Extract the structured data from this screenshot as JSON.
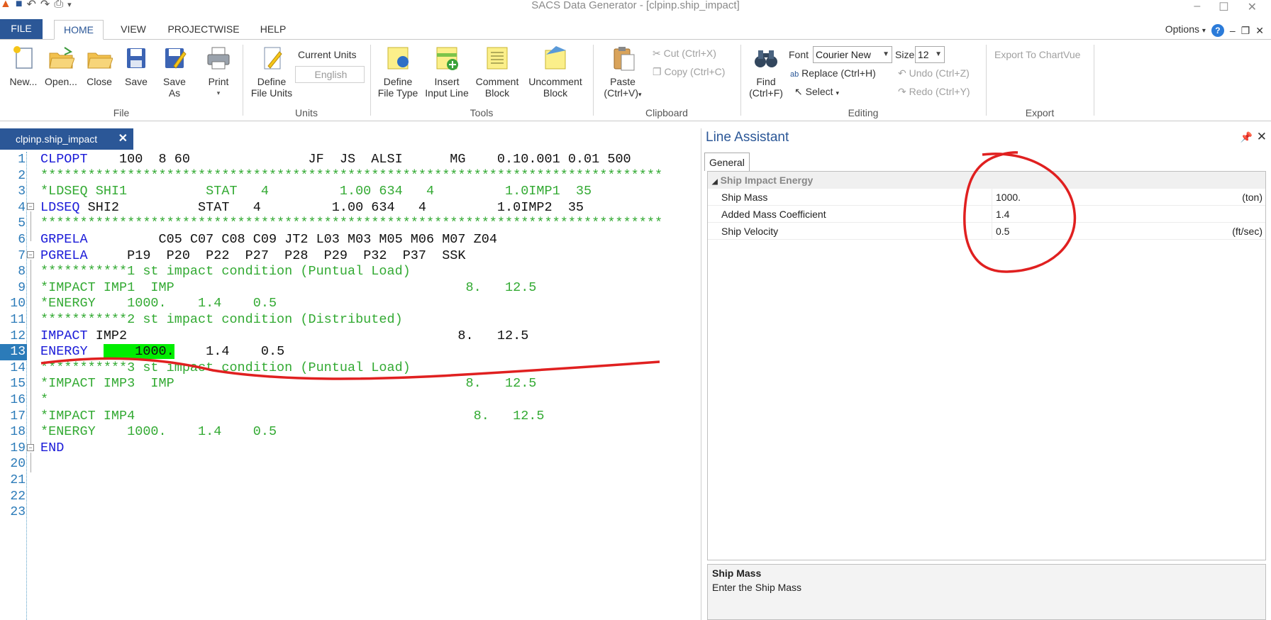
{
  "window": {
    "title": "SACS Data Generator - [clpinp.ship_impact]"
  },
  "ribbon_tabs": [
    "FILE",
    "HOME",
    "VIEW",
    "PROJECTWISE",
    "HELP"
  ],
  "options": {
    "label": "Options"
  },
  "ribbon": {
    "file_group": {
      "label": "File",
      "new": "New...",
      "open": "Open...",
      "close": "Close",
      "save": "Save",
      "save_as_1": "Save",
      "save_as_2": "As",
      "print": "Print"
    },
    "units_group": {
      "label": "Units",
      "define_1": "Define",
      "define_2": "File Units",
      "current_units_label": "Current Units",
      "current_units_value": "English"
    },
    "tools_group": {
      "label": "Tools",
      "define_type_1": "Define",
      "define_type_2": "File Type",
      "insert_1": "Insert",
      "insert_2": "Input Line",
      "comment_1": "Comment",
      "comment_2": "Block",
      "uncomment_1": "Uncomment",
      "uncomment_2": "Block"
    },
    "clipboard_group": {
      "label": "Clipboard",
      "paste_1": "Paste",
      "paste_2": "(Ctrl+V)",
      "cut": "Cut (Ctrl+X)",
      "copy": "Copy (Ctrl+C)"
    },
    "editing_group": {
      "label": "Editing",
      "find_1": "Find",
      "find_2": "(Ctrl+F)",
      "font_label": "Font",
      "font_value": "Courier New",
      "size_label": "Size",
      "size_value": "12",
      "replace": "Replace (Ctrl+H)",
      "select": "Select",
      "undo": "Undo (Ctrl+Z)",
      "redo": "Redo (Ctrl+Y)"
    },
    "export_group": {
      "label": "Export",
      "export_chartvue": "Export To ChartVue"
    }
  },
  "editor": {
    "tab_label": "clpinp.ship_impact",
    "lines": [
      {
        "n": "1",
        "parts": [
          [
            "kw",
            "CLPOPT"
          ],
          [
            "tx",
            "    100  8 60               JF  JS  ALSI      MG    0.10.001 0.01 500"
          ]
        ]
      },
      {
        "n": "2",
        "parts": [
          [
            "cm",
            "*******************************************************************************"
          ]
        ]
      },
      {
        "n": "3",
        "parts": [
          [
            "cm",
            "*LDSEQ SHI1          STAT   4         1.00 634   4         1.0IMP1  35"
          ]
        ]
      },
      {
        "n": "4",
        "parts": [
          [
            "kw",
            "LDSEQ"
          ],
          [
            "tx",
            " SHI2          STAT   4         1.00 634   4         1.0IMP2  35"
          ]
        ]
      },
      {
        "n": "5",
        "parts": [
          [
            "cm",
            "*******************************************************************************"
          ]
        ]
      },
      {
        "n": "6",
        "parts": [
          [
            "kw",
            "GRPELA"
          ],
          [
            "tx",
            "         C05 C07 C08 C09 JT2 L03 M03 M05 M06 M07 Z04"
          ]
        ]
      },
      {
        "n": "7",
        "parts": [
          [
            "kw",
            "PGRELA"
          ],
          [
            "tx",
            "     P19  P20  P22  P27  P28  P29  P32  P37  SSK"
          ]
        ]
      },
      {
        "n": "8",
        "parts": [
          [
            "cm",
            "***********1 st impact condition (Puntual Load)"
          ]
        ]
      },
      {
        "n": "9",
        "parts": [
          [
            "cm",
            "*IMPACT IMP1  IMP                                     8.   12.5"
          ]
        ]
      },
      {
        "n": "10",
        "parts": [
          [
            "cm",
            "*ENERGY    1000.    1.4    0.5"
          ]
        ]
      },
      {
        "n": "11",
        "parts": [
          [
            "cm",
            "***********2 st impact condition (Distributed)"
          ]
        ]
      },
      {
        "n": "12",
        "parts": [
          [
            "kw",
            "IMPACT"
          ],
          [
            "tx",
            " IMP2                                          8.   12.5"
          ]
        ]
      },
      {
        "n": "13",
        "parts": [
          [
            "kw",
            "ENERGY"
          ],
          [
            "tx",
            "  "
          ],
          [
            "hl",
            "    1000."
          ],
          [
            "tx",
            "    1.4    0.5"
          ]
        ]
      },
      {
        "n": "14",
        "parts": [
          [
            "cm",
            "***********3 st impact condition (Puntual Load)"
          ]
        ]
      },
      {
        "n": "15",
        "parts": [
          [
            "cm",
            "*IMPACT IMP3  IMP                                     8.   12.5"
          ]
        ]
      },
      {
        "n": "16",
        "parts": [
          [
            "cm",
            "*"
          ]
        ]
      },
      {
        "n": "17",
        "parts": [
          [
            "cm",
            "*IMPACT IMP4                                           8.   12.5"
          ]
        ]
      },
      {
        "n": "18",
        "parts": [
          [
            "cm",
            "*ENERGY    1000.    1.4    0.5"
          ]
        ]
      },
      {
        "n": "19",
        "parts": [
          [
            "kw",
            "END"
          ]
        ]
      },
      {
        "n": "20",
        "parts": []
      },
      {
        "n": "21",
        "parts": []
      },
      {
        "n": "22",
        "parts": []
      },
      {
        "n": "23",
        "parts": []
      }
    ],
    "current_line": "13"
  },
  "assistant": {
    "title": "Line Assistant",
    "tab": "General",
    "category": "Ship Impact Energy",
    "rows": [
      {
        "name": "Ship Mass",
        "value": "1000.",
        "unit": "(ton)"
      },
      {
        "name": "Added Mass Coefficient",
        "value": "1.4",
        "unit": ""
      },
      {
        "name": "Ship Velocity",
        "value": "0.5",
        "unit": "(ft/sec)"
      }
    ],
    "description_title": "Ship Mass",
    "description_text": "Enter the Ship Mass"
  },
  "colors": {
    "accent": "#2b5797",
    "keyword": "#1a1ad8",
    "comment": "#33aa33",
    "highlight": "#00ee00",
    "annotation": "#e02020"
  }
}
